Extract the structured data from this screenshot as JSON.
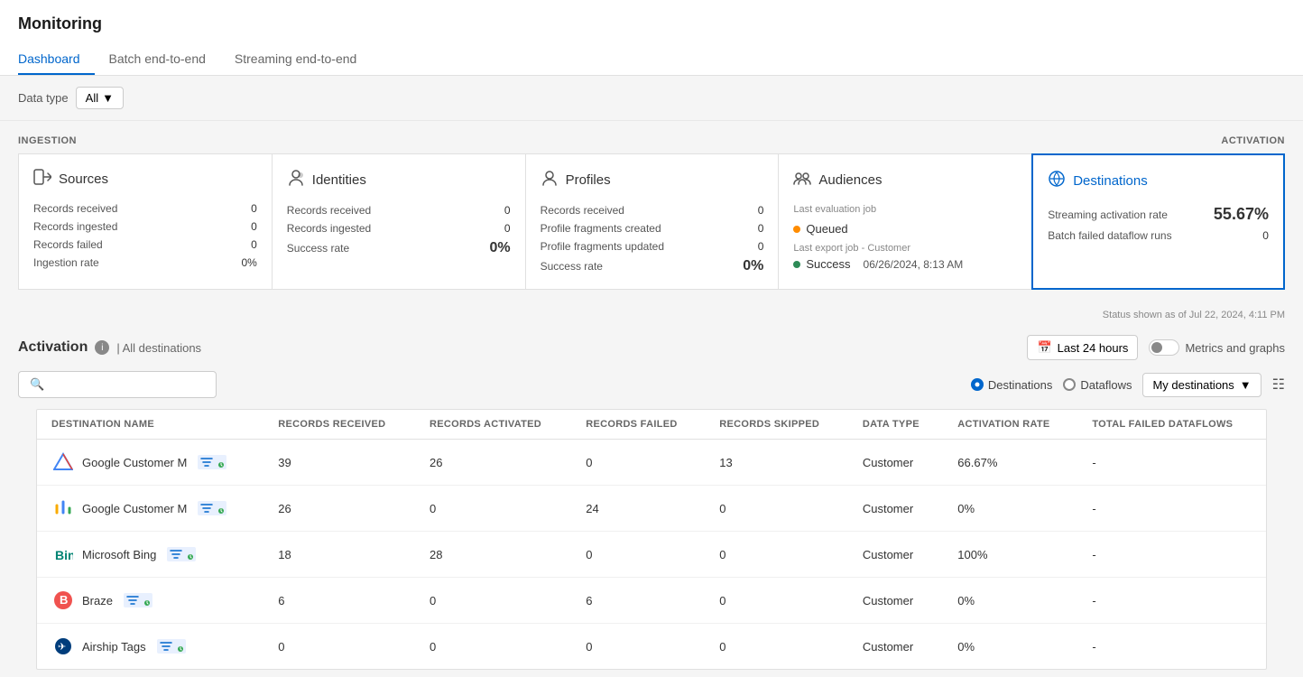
{
  "header": {
    "title": "Monitoring",
    "tabs": [
      {
        "label": "Dashboard",
        "active": true
      },
      {
        "label": "Batch end-to-end",
        "active": false
      },
      {
        "label": "Streaming end-to-end",
        "active": false
      }
    ]
  },
  "toolbar": {
    "data_type_label": "Data type",
    "data_type_value": "All"
  },
  "section_labels": {
    "ingestion": "INGESTION",
    "activation": "ACTIVATION"
  },
  "cards": {
    "sources": {
      "title": "Sources",
      "rows": [
        {
          "label": "Records received",
          "value": "0"
        },
        {
          "label": "Records ingested",
          "value": "0"
        },
        {
          "label": "Records failed",
          "value": "0"
        },
        {
          "label": "Ingestion rate",
          "value": "0%"
        }
      ]
    },
    "identities": {
      "title": "Identities",
      "rows": [
        {
          "label": "Records received",
          "value": "0"
        },
        {
          "label": "Records ingested",
          "value": "0"
        },
        {
          "label": "Success rate",
          "value": "0%"
        }
      ]
    },
    "profiles": {
      "title": "Profiles",
      "rows": [
        {
          "label": "Records received",
          "value": "0"
        },
        {
          "label": "Profile fragments created",
          "value": "0"
        },
        {
          "label": "Profile fragments updated",
          "value": "0"
        },
        {
          "label": "Success rate",
          "value": "0%"
        }
      ]
    },
    "audiences": {
      "title": "Audiences",
      "eval_label": "Last evaluation job",
      "queued_label": "Queued",
      "export_label": "Last export job - Customer",
      "success_label": "Success",
      "success_date": "06/26/2024, 8:13 AM"
    },
    "destinations": {
      "title": "Destinations",
      "streaming_label": "Streaming activation rate",
      "streaming_value": "55.67%",
      "batch_label": "Batch failed dataflow runs",
      "batch_value": "0"
    }
  },
  "status_footer": "Status shown as of Jul 22, 2024, 4:11 PM",
  "activation": {
    "title": "Activation",
    "filter_label": "| All destinations",
    "time_label": "Last 24 hours",
    "metrics_label": "Metrics and graphs",
    "search_placeholder": "",
    "destinations_radio": "Destinations",
    "dataflows_radio": "Dataflows",
    "dropdown_label": "My destinations",
    "table": {
      "columns": [
        "DESTINATION NAME",
        "RECORDS RECEIVED",
        "RECORDS ACTIVATED",
        "RECORDS FAILED",
        "RECORDS SKIPPED",
        "DATA TYPE",
        "ACTIVATION RATE",
        "TOTAL FAILED DATAFLOWS"
      ],
      "rows": [
        {
          "name": "Google Customer M",
          "logo_type": "google-ads",
          "logo_text": "▶",
          "records_received": "39",
          "records_activated": "26",
          "records_failed": "0",
          "records_skipped": "13",
          "data_type": "Customer",
          "activation_rate": "66.67%",
          "failed_dataflows": "-"
        },
        {
          "name": "Google Customer M",
          "logo_type": "google-analytics",
          "logo_text": "▲",
          "records_received": "26",
          "records_activated": "0",
          "records_failed": "24",
          "records_skipped": "0",
          "data_type": "Customer",
          "activation_rate": "0%",
          "failed_dataflows": "-"
        },
        {
          "name": "Microsoft Bing",
          "logo_type": "bing",
          "logo_text": "b",
          "records_received": "18",
          "records_activated": "28",
          "records_failed": "0",
          "records_skipped": "0",
          "data_type": "Customer",
          "activation_rate": "100%",
          "failed_dataflows": "-"
        },
        {
          "name": "Braze",
          "logo_type": "braze",
          "logo_text": "B",
          "records_received": "6",
          "records_activated": "0",
          "records_failed": "6",
          "records_skipped": "0",
          "data_type": "Customer",
          "activation_rate": "0%",
          "failed_dataflows": "-"
        },
        {
          "name": "Airship Tags",
          "logo_type": "airship",
          "logo_text": "✈",
          "records_received": "0",
          "records_activated": "0",
          "records_failed": "0",
          "records_skipped": "0",
          "data_type": "Customer",
          "activation_rate": "0%",
          "failed_dataflows": "-"
        }
      ]
    }
  }
}
